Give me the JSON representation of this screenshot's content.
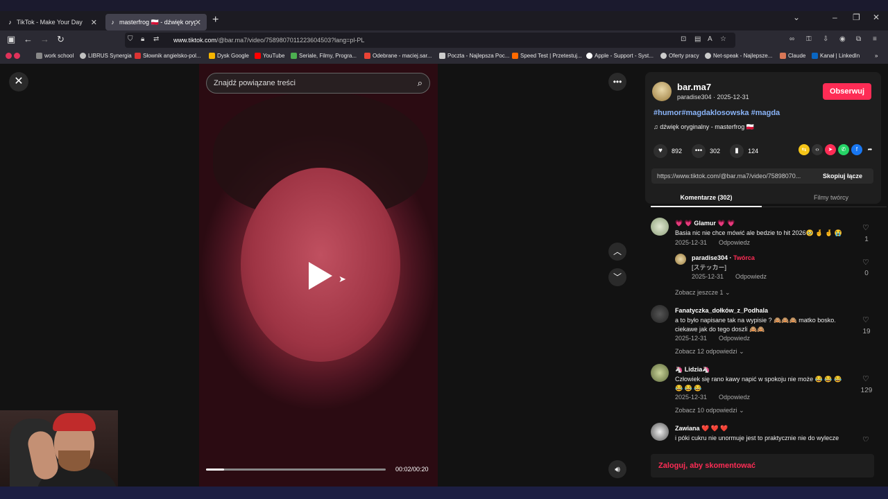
{
  "browser": {
    "tabs": [
      {
        "title": "TikTok - Make Your Day"
      },
      {
        "title": "masterfrog 🇵🇱 - dźwięk orygi"
      }
    ],
    "new_tab_icon": "plus-icon",
    "url": {
      "domain": "www.tiktok.com",
      "path": "/@bar.ma7/video/7589807011223604503?lang=pl-PL"
    },
    "bookmarks": [
      {
        "label": "",
        "color": "#e0325a"
      },
      {
        "label": "work school",
        "color": "#888888"
      },
      {
        "label": "LIBRUS Synergia",
        "color": "#c0c0c0"
      },
      {
        "label": "Słownik angielsko-pol...",
        "color": "#d33"
      },
      {
        "label": "Dysk Google",
        "color": "#f4b400"
      },
      {
        "label": "YouTube",
        "color": "#ff0000"
      },
      {
        "label": "Seriale, Filmy, Progra...",
        "color": "#4caf50"
      },
      {
        "label": "Odebrane - maciej.sar...",
        "color": "#ea4335"
      },
      {
        "label": "Poczta - Najlepsza Poc...",
        "color": "#cccccc"
      },
      {
        "label": "Speed Test | Przetestuj...",
        "color": "#ff6a00"
      },
      {
        "label": "Apple - Support - Syst...",
        "color": "#ffffff"
      },
      {
        "label": "Oferty pracy",
        "color": "#cccccc"
      },
      {
        "label": "Net-speak - Najlepsze...",
        "color": "#cccccc"
      },
      {
        "label": "Claude",
        "color": "#d97757"
      },
      {
        "label": "Kanał | LinkedIn",
        "color": "#0a66c2"
      }
    ]
  },
  "video": {
    "search_placeholder": "Znajdź powiązane treści",
    "time": "00:02/00:20",
    "progress": 0.1
  },
  "post": {
    "username": "bar.ma7",
    "meta": "paradise304 · 2025-12-31",
    "follow": "Obserwuj",
    "tags": "#humor#magdaklosowska #magda",
    "music": "dźwięk oryginalny - masterfrog 🇵🇱",
    "likes": "892",
    "comments": "302",
    "saves": "124",
    "link": "https://www.tiktok.com/@bar.ma7/video/75898070...",
    "copy": "Skopiuj łącze"
  },
  "tabs": {
    "comments": "Komentarze (302)",
    "creator_videos": "Filmy twórcy"
  },
  "comments": [
    {
      "name": "💗 💗 Glamur 💗 💗",
      "text": "Basia nic nie chce mówić ale bedzie to hit 2026🥹 🤞 🤞 😭",
      "date": "2025-12-31",
      "reply": "Odpowiedz",
      "likes": "1"
    },
    {
      "name": "paradise304",
      "badge": "Twórca",
      "text": "[ステッカー]",
      "date": "2025-12-31",
      "reply": "Odpowiedz",
      "likes": "0"
    },
    {
      "more": "Zobacz jeszcze 1"
    },
    {
      "name": "Fanatyczka_dołków_z_Podhala",
      "text": "a to było napisane tak na wypisie ? 🙈🙈🙈 matko bosko.",
      "text2": "ciekawe jak do tego doszli 🙈🙈",
      "date": "2025-12-31",
      "reply": "Odpowiedz",
      "likes": "19"
    },
    {
      "more": "Zobacz 12 odpowiedzi"
    },
    {
      "name": "🦄 Lidzia🦄",
      "text": "Człowiek się rano kawy napić w spokoju nie może 😂 😂 😂",
      "text2": "😂 😂 😂",
      "date": "2025-12-31",
      "reply": "Odpowiedz",
      "likes": "129"
    },
    {
      "more": "Zobacz 10 odpowiedzi"
    },
    {
      "name": "Zawiana ❤️ ❤️ ❤️",
      "text": "i póki cukru nie unormuje jest to praktycznie nie do wylecze"
    }
  ],
  "login": "Zaloguj, aby skomentować"
}
